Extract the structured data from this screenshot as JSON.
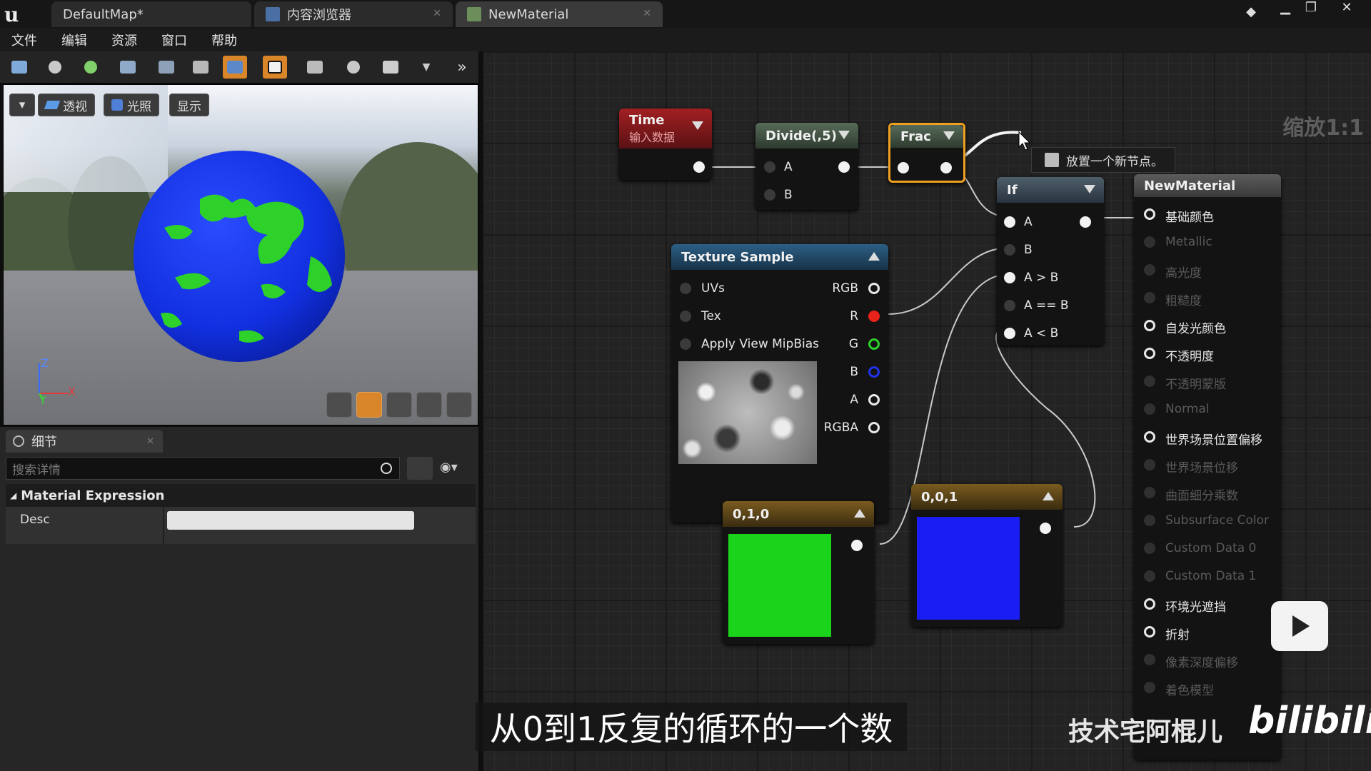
{
  "tabs": [
    {
      "label": "DefaultMap*"
    },
    {
      "label": "内容浏览器"
    },
    {
      "label": "NewMaterial"
    }
  ],
  "menu": [
    "文件",
    "编辑",
    "资源",
    "窗口",
    "帮助"
  ],
  "viewport": {
    "buttons": [
      "透视",
      "光照",
      "显示"
    ],
    "axis": {
      "z": "Z",
      "y": "Y",
      "x": "X"
    }
  },
  "details": {
    "tab_label": "细节",
    "search_placeholder": "搜索详情",
    "category": "Material Expression",
    "desc_label": "Desc",
    "desc_value": ""
  },
  "graph": {
    "zoom_label": "缩放1:1",
    "tooltip": "放置一个新节点。",
    "nodes": {
      "time": {
        "title": "Time",
        "subtitle": "输入数据"
      },
      "divide": {
        "title": "Divide(,5)",
        "pins": [
          "A",
          "B"
        ]
      },
      "frac": {
        "title": "Frac"
      },
      "if": {
        "title": "If",
        "pins": [
          "A",
          "B",
          "A > B",
          "A == B",
          "A < B"
        ]
      },
      "texture": {
        "title": "Texture Sample",
        "inputs": [
          "UVs",
          "Tex",
          "Apply View MipBias"
        ],
        "outputs": [
          "RGB",
          "R",
          "G",
          "B",
          "A",
          "RGBA"
        ]
      },
      "green_const": {
        "title": "0,1,0",
        "color": "#19d41b"
      },
      "blue_const": {
        "title": "0,0,1",
        "color": "#1a1ef5"
      },
      "material": {
        "title": "NewMaterial",
        "pins": [
          {
            "label": "基础颜色",
            "active": true
          },
          {
            "label": "Metallic",
            "active": false
          },
          {
            "label": "高光度",
            "active": false
          },
          {
            "label": "粗糙度",
            "active": false
          },
          {
            "label": "自发光颜色",
            "active": true
          },
          {
            "label": "不透明度",
            "active": true
          },
          {
            "label": "不透明蒙版",
            "active": false
          },
          {
            "label": "Normal",
            "active": false
          },
          {
            "label": "世界场景位置偏移",
            "active": true
          },
          {
            "label": "世界场景位移",
            "active": false
          },
          {
            "label": "曲面细分乘数",
            "active": false
          },
          {
            "label": "Subsurface Color",
            "active": false
          },
          {
            "label": "Custom Data 0",
            "active": false
          },
          {
            "label": "Custom Data 1",
            "active": false
          },
          {
            "label": "环境光遮挡",
            "active": true
          },
          {
            "label": "折射",
            "active": true
          },
          {
            "label": "像素深度偏移",
            "active": false
          },
          {
            "label": "着色模型",
            "active": false
          }
        ]
      }
    }
  },
  "subtitle": "从0到1反复的循环的一个数",
  "watermark": {
    "author": "技术宅阿棍儿",
    "brand": "bilibili"
  },
  "colors": {
    "accent": "#d9862a",
    "sphere_ocean": "#1232e8",
    "sphere_land": "#2ed12a"
  }
}
